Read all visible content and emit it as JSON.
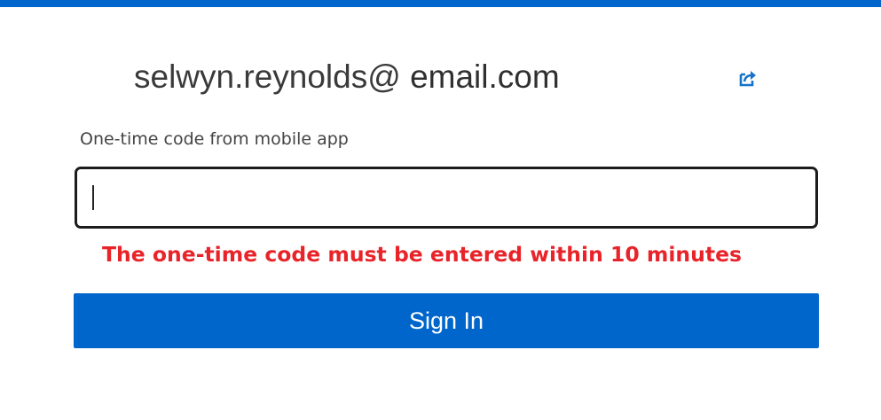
{
  "header": {
    "accent_color": "#0066cc"
  },
  "account": {
    "email_user": "selwyn.reynolds@",
    "email_domain": " email.com",
    "switch_icon": "external-link-arrow-icon"
  },
  "code_field": {
    "label": "One-time code from mobile app",
    "value": "",
    "placeholder": ""
  },
  "warning": {
    "text": "The one-time code must be entered within 10 minutes",
    "color": "#e8242a"
  },
  "sign_in": {
    "label": "Sign In",
    "color": "#0066cc"
  }
}
